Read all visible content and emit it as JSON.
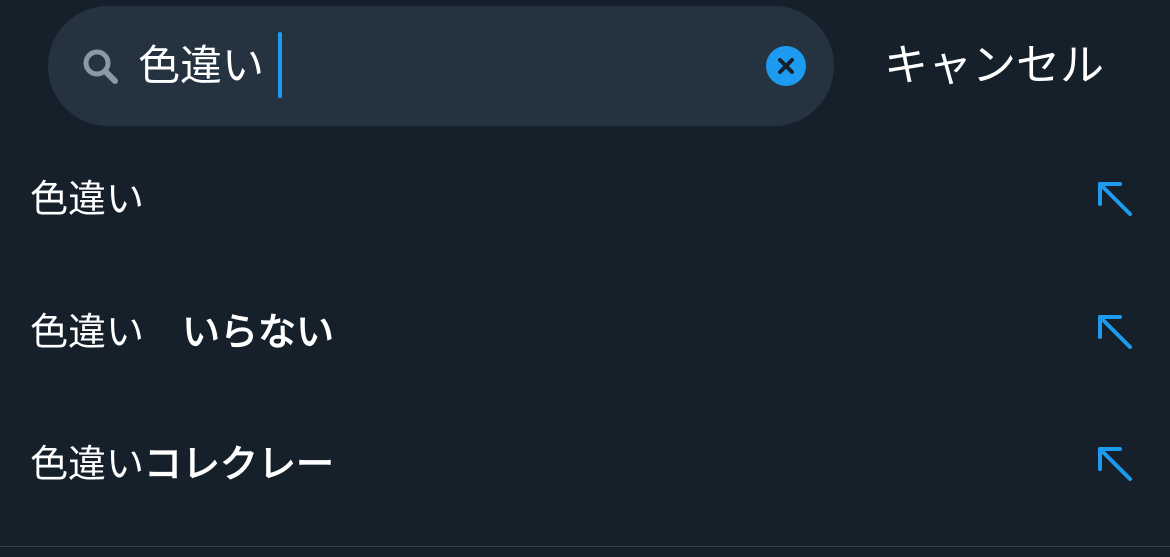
{
  "search": {
    "query": "色違い",
    "clear_icon": "close-circle-icon",
    "search_icon": "search-icon"
  },
  "header": {
    "cancel_label": "キャンセル"
  },
  "suggestions": [
    {
      "query_part": "色違い",
      "completion": "",
      "icon": "arrow-up-left-icon"
    },
    {
      "query_part": "色違い　",
      "completion": "いらない",
      "icon": "arrow-up-left-icon"
    },
    {
      "query_part": "色違い",
      "completion": "コレクレー",
      "icon": "arrow-up-left-icon"
    }
  ],
  "colors": {
    "background": "#15202b",
    "search_field": "#253341",
    "accent": "#1d9bf0",
    "text": "#ffffff",
    "icon_muted": "#8b98a5"
  }
}
